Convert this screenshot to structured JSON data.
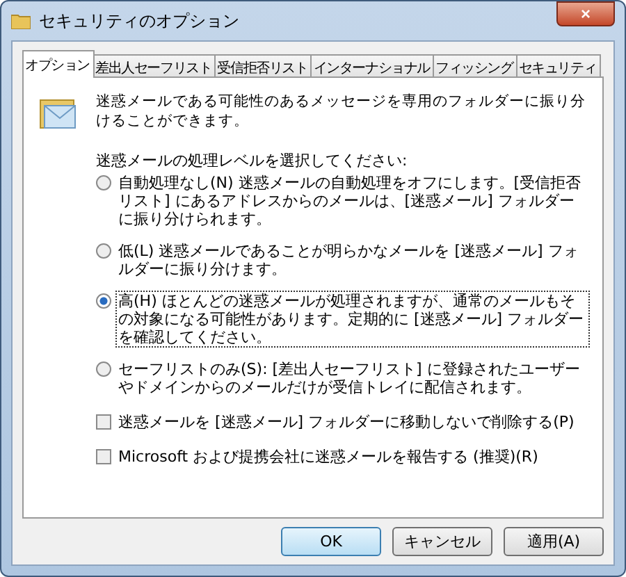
{
  "window": {
    "title": "セキュリティのオプション",
    "close": "×"
  },
  "tabs": [
    {
      "label": "オプション",
      "selected": true
    },
    {
      "label": "差出人セーフリスト",
      "selected": false
    },
    {
      "label": "受信拒否リスト",
      "selected": false
    },
    {
      "label": "インターナショナル",
      "selected": false
    },
    {
      "label": "フィッシング",
      "selected": false
    },
    {
      "label": "セキュリティ",
      "selected": false
    }
  ],
  "intro": "迷惑メールである可能性のあるメッセージを専用のフォルダーに振り分けることができます。",
  "level_prompt": "迷惑メールの処理レベルを選択してください:",
  "levels": [
    {
      "label": "自動処理なし(N) 迷惑メールの自動処理をオフにします。[受信拒否リスト] にあるアドレスからのメールは、[迷惑メール] フォルダーに振り分けられます。",
      "selected": false
    },
    {
      "label": "低(L) 迷惑メールであることが明らかなメールを [迷惑メール] フォルダーに振り分けます。",
      "selected": false
    },
    {
      "label": "高(H) ほとんどの迷惑メールが処理されますが、通常のメールもその対象になる可能性があります。定期的に [迷惑メール] フォルダーを確認してください。",
      "selected": true
    },
    {
      "label": "セーフリストのみ(S): [差出人セーフリスト] に登録されたユーザーやドメインからのメールだけが受信トレイに配信されます。",
      "selected": false
    }
  ],
  "options": [
    {
      "label": "迷惑メールを [迷惑メール] フォルダーに移動しないで削除する(P)",
      "checked": false
    },
    {
      "label": "Microsoft および提携会社に迷惑メールを報告する (推奨)(R)",
      "checked": false
    }
  ],
  "buttons": [
    {
      "label": "OK",
      "default": true
    },
    {
      "label": "キャンセル",
      "default": false
    },
    {
      "label": "適用(A)",
      "default": false
    }
  ]
}
